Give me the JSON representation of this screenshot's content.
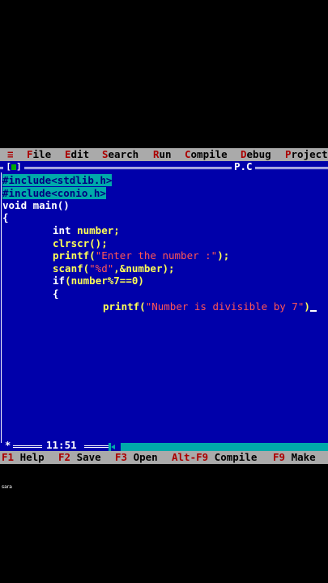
{
  "menu": {
    "system_icon": "≡",
    "items": [
      {
        "hot": "F",
        "rest": "ile"
      },
      {
        "hot": "E",
        "rest": "dit"
      },
      {
        "hot": "S",
        "rest": "earch"
      },
      {
        "hot": "R",
        "rest": "un"
      },
      {
        "hot": "C",
        "rest": "ompile"
      },
      {
        "hot": "D",
        "rest": "ebug"
      },
      {
        "hot": "P",
        "rest": "roject"
      }
    ]
  },
  "window": {
    "close_label": "[",
    "close_label_end": "]",
    "title": "P.C"
  },
  "code": {
    "line1": "#include<stdlib.h>",
    "line2": "#include<conio.h>",
    "line3": "void main()",
    "line4": "{",
    "line5_kw": "int ",
    "line5_id": "number;",
    "line6": "clrscr();",
    "line7_a": "printf(",
    "line7_str": "\"Enter the number :\"",
    "line7_b": ");",
    "line8_a": "scanf(",
    "line8_str": "\"%d\"",
    "line8_b": ",&number);",
    "line9_kw": "if",
    "line9_id": "(number%7==0)",
    "line10": "{",
    "line11_a": "printf(",
    "line11_str": "\"Number is divisible by 7\"",
    "line11_b": ")"
  },
  "status": {
    "modified_marker": "*",
    "position": "11:51"
  },
  "fkeys": [
    {
      "key": "F1",
      "label": " Help"
    },
    {
      "key": "F2",
      "label": " Save"
    },
    {
      "key": "F3",
      "label": " Open"
    },
    {
      "key": "Alt-F9",
      "label": " Compile"
    },
    {
      "key": "F9",
      "label": " Make"
    }
  ],
  "watermark": "sara"
}
